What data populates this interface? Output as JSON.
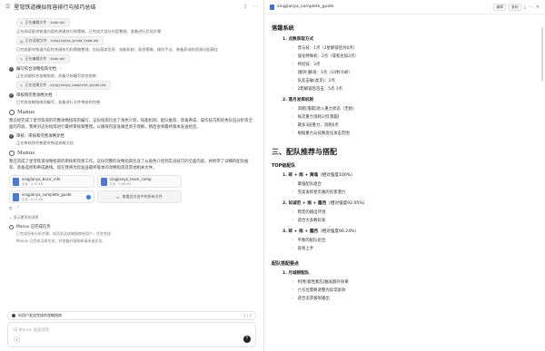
{
  "left": {
    "title": "星穹铁道模拟阵容排行与技巧总结",
    "steps": [
      {
        "text": "阅读用户提供的文件",
        "chip": "todo.md",
        "desc": "正在阅读星穹铁道内容的关键技巧和策略，已完成大部分内容整理，准备进行后续步骤",
        "chip2": "xingjianya_prime_team.md",
        "desc2": "已完成星穹铁道内容的关键技巧和策略整理，包括基本信息、技能机制、组合策略、操作手法、装备养成和资源分配建议",
        "chip3": "todo.md"
      },
      {
        "text": "编写综合攻略指南文档",
        "desc": "正在创建综合攻略指南，准备开始编写综合指南",
        "chip": "xingjianya_complete_guide.md"
      },
      {
        "text": "审核和完善攻略文档",
        "desc": "已完成攻略指南的编写，准备进行文件审核和完善"
      }
    ],
    "brand": "Manus",
    "para1": "我已经完成了星穹铁道的完整攻略指南的编写。这份指南包含了角色介绍、技能机制、配队推荐、装备养成、操作技巧和优秀队伍分析等全面的内容。我将对这份指南进行最终审核和整理，以确保内容准确且易于理解，稍后会将最终版本发送给您。",
    "step4": "审核：审核和完善攻略文档",
    "step4desc": "正在审核和完善星穹铁道攻略文档",
    "para2": "我已完成了星穹铁道攻略指南的审核和完善工作。这份完整的攻略指南包含了从角色介绍到实战技巧的全面内容，并附带了详细的配队推荐、装备选择和养成路线。现在我将为您发送最终版本的攻略指南及其他相关文件。",
    "files": [
      {
        "name": "xingjianya_basic_info",
        "meta": "文本 · 3.29 KB"
      },
      {
        "name": "xingjianya_team_comp",
        "meta": "文本 · 5.66 KB"
      },
      {
        "name": "xingjianya_complete_guide",
        "meta": "文本 · 6.55 KB"
      }
    ],
    "view_all": "查看此任务中的所有文件",
    "collapse": "显示更早的消息",
    "status_title": "Manus 已完成任务",
    "status_body1": "已完成所有分析步骤，成功发送攻略指南给用户，任务完成",
    "status_body2": "Manus 已完成当前任务，并准备好接收新请求或任务。",
    "taskbar_text": "向用户发送完成的攻略指南",
    "taskbar_count": "7 / 7",
    "composer_placeholder": "向 Manus 发送消息"
  },
  "right": {
    "filename": "xingjianya_complete_guide",
    "btn_edit": "编辑",
    "btn_copy": "复制",
    "section1": "落霜系统",
    "ol1": "1. 点数获取方式",
    "ol1_items": [
      "普与技：1点（2星解锁后为6点）",
      "强化特殊机：2点（或者也加2点）",
      "终结技：3点",
      "[额外]解发：1点（10秒冷却）",
      "队友击破(类见)：2点",
      "2影解锁后首击：5点 1点"
    ],
    "ol2": "2. 落月发挥机制",
    "ol2_items": [
      "消耗[落霜]进入重力状态（无损）",
      "每次重力消耗2点[落霜]",
      "最多3层重力，消耗6点",
      "根据重力与技数变化攻击范围"
    ],
    "section2": "三、配队推荐与搭配",
    "top_team": "TOP级配队",
    "teams": [
      {
        "name": "1. 碎 + 雨 + 黄魂",
        "rate": "（相对强度100%）",
        "items": [
          "最强配队组合",
          "完美发挥星见雅的伤害潜力"
        ]
      },
      {
        "name": "2. 如诚范 + 雨 + 露西",
        "rate": "（相对强度92.05%）",
        "items": [
          "稳定的输出环境",
          "适合大多数玩家"
        ]
      },
      {
        "name": "3. 碎 + 雨 + 露西",
        "rate": "（相对强度90.24%）",
        "items": [
          "平衡的配队组合",
          "容易上手"
        ]
      }
    ],
    "tips_title": "配队搭配要点",
    "tip1": "1. 月城柳配队",
    "tip1_items": [
      "利用[极性紊乱]触发额外效果",
      "六号位需要调整为异常驱效",
      "适合追求极限输出"
    ]
  }
}
